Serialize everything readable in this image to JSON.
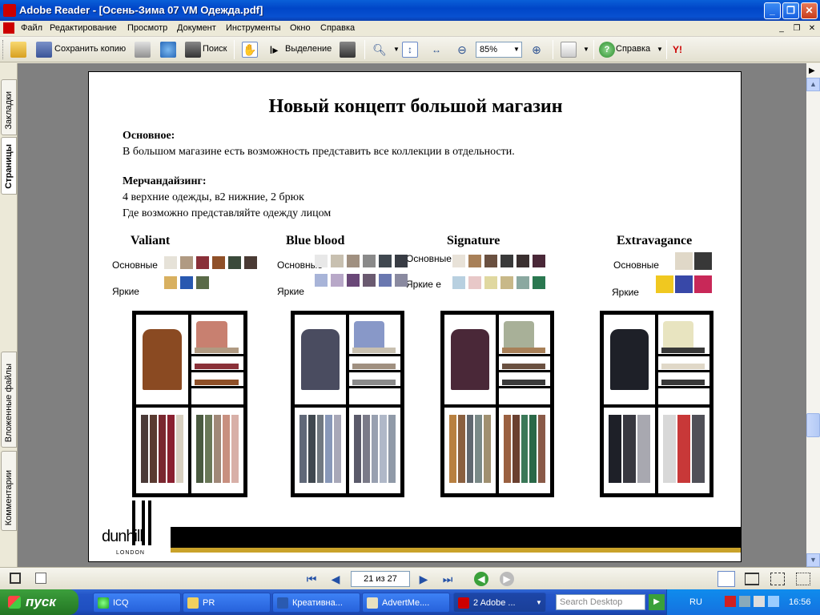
{
  "window": {
    "title": "Adobe Reader - [Осень-Зима 07 VM Одежда.pdf]"
  },
  "menu": [
    "Файл",
    "Редактирование",
    "Просмотр",
    "Документ",
    "Инструменты",
    "Окно",
    "Справка"
  ],
  "toolbar": {
    "save_copy": "Сохранить копию",
    "search": "Поиск",
    "select": "Выделение",
    "zoom": "85%",
    "help": "Справка"
  },
  "left_tabs": {
    "bookmarks": "Закладки",
    "pages": "Страницы",
    "attachments": "Вложенные файлы",
    "comments": "Комментарии"
  },
  "page": {
    "title": "Новый концепт большой магазин",
    "basic_heading": "Основное:",
    "basic_text": "В большом магазине есть возможность представить все коллекции в отдельности.",
    "merch_heading": "Мерчандайзинг:",
    "merch_line1": "4 верхние одежды, в2 нижние, 2 брюк",
    "merch_line2": "Где возможно представляйте одежду лицом",
    "label_basic": "Основные",
    "label_bright": "Яркие",
    "label_bright_signature": "Яркие е",
    "brand_name": "dunhill",
    "brand_city": "LONDON"
  },
  "collections": [
    {
      "name": "Valiant",
      "basic": [
        "#e6e2d8",
        "#b09a82",
        "#8a3038",
        "#8f5028",
        "#3a4a3a",
        "#4a3a34"
      ],
      "bright": [
        "#d8b060",
        "#2858b0",
        "#5a6a48"
      ],
      "jacket": "#8a4a22",
      "shirt": "#c88070",
      "pants": [
        "#4a3a38",
        "#5a3a30",
        "#7a2830",
        "#8a2030",
        "#d8d0c0",
        "#4a5a40",
        "#6a7858",
        "#a08878",
        "#c89080",
        "#d8b0a8"
      ]
    },
    {
      "name": "Blue blood",
      "basic": [
        "#e8e8e8",
        "#c8c0b0",
        "#a09080",
        "#8a8a8a",
        "#404850",
        "#383c44"
      ],
      "bright": [
        "#a8b4d8",
        "#b8a8c8",
        "#6a4878",
        "#6a5a70",
        "#6a78b0",
        "#8a8aa0"
      ],
      "jacket": "#4a4c60",
      "shirt": "#8898c8",
      "pants": [
        "#606878",
        "#404850",
        "#707880",
        "#8898b8",
        "#a8a8b8",
        "#5a5a6a",
        "#7a7a88",
        "#98a0b0",
        "#b0b8c8",
        "#909aa8"
      ]
    },
    {
      "name": "Signature",
      "basic": [
        "#e8e2d8",
        "#a88058",
        "#6a5040",
        "#3a3a3a",
        "#3a3030",
        "#4a2838"
      ],
      "bright": [
        "#b8d0e0",
        "#e8c8c8",
        "#e0d8a0",
        "#c8b888",
        "#8aa8a0",
        "#2a7850"
      ],
      "jacket": "#4a2838",
      "shirt": "#a8b098",
      "pants": [
        "#b88040",
        "#8a6040",
        "#606870",
        "#7a8a88",
        "#a09070",
        "#9a6040",
        "#6a4030",
        "#3a7858",
        "#2a6848",
        "#8a5a48"
      ]
    },
    {
      "name": "Extravagance",
      "basic": [
        "#e0d8c8",
        "#383838"
      ],
      "bright": [
        "#f0c820",
        "#3848a8",
        "#c82858"
      ],
      "jacket": "#1e2028",
      "shirt": "#e8e4c0",
      "pants": [
        "#1e2028",
        "#383840",
        "#a8a8b0",
        "#d8d8d8",
        "#c83838",
        "#505058"
      ]
    }
  ],
  "navigation": {
    "page_indicator": "21 из 27"
  },
  "taskbar": {
    "start": "пуск",
    "tasks": [
      "ICQ",
      "PR",
      "Креативна...",
      "AdvertMe....",
      "2 Adobe ..."
    ],
    "search_placeholder": "Search Desktop",
    "lang": "RU",
    "clock": "16:56"
  },
  "colors": {
    "accent_gold": "#c9a22a",
    "titlebar_blue": "#0a5fd8",
    "taskbar_blue": "#2456c8",
    "start_green": "#2f8a2f"
  }
}
